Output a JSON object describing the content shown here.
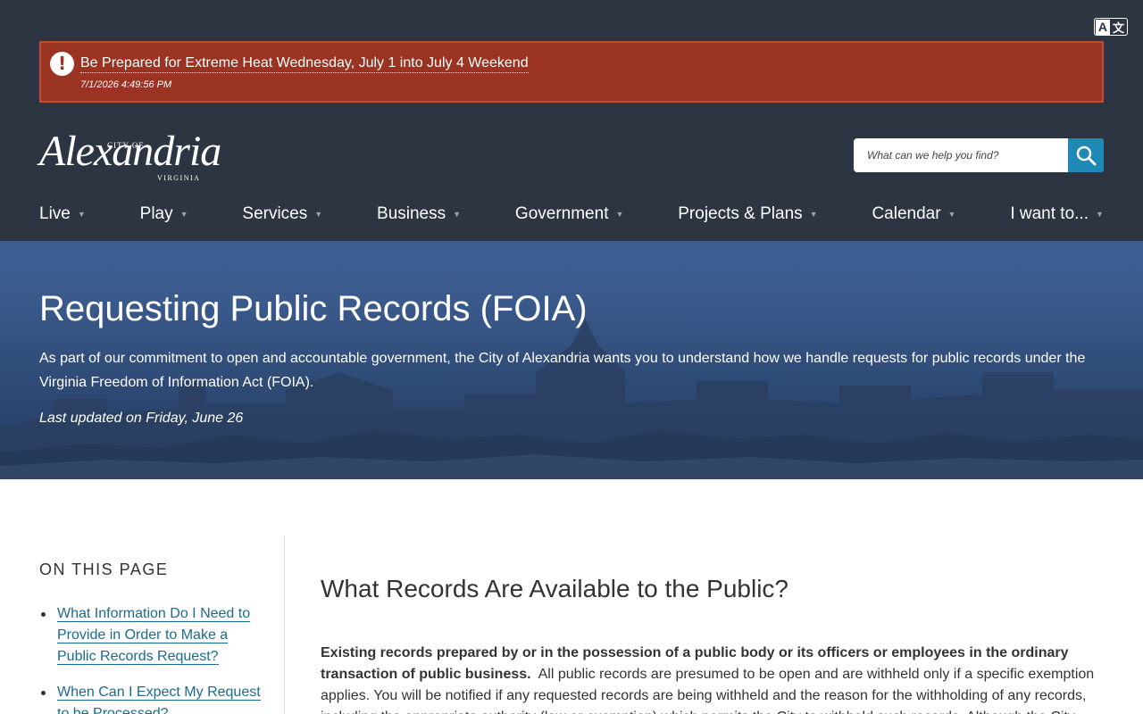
{
  "header": {
    "translate_label_a": "A",
    "translate_label_b": "文",
    "alert": {
      "title": "Be Prepared for Extreme Heat Wednesday, July 1 into July 4 Weekend",
      "timestamp": "7/1/2026 4:49:56 PM"
    },
    "logo": {
      "city_of": "CITY OF",
      "name": "Alexandria",
      "state": "VIRGINIA"
    },
    "search": {
      "placeholder": "What can we help you find?"
    },
    "nav": [
      {
        "label": "Live"
      },
      {
        "label": "Play"
      },
      {
        "label": "Services"
      },
      {
        "label": "Business"
      },
      {
        "label": "Government"
      },
      {
        "label": "Projects & Plans"
      },
      {
        "label": "Calendar"
      },
      {
        "label": "I want to..."
      }
    ]
  },
  "hero": {
    "title": "Requesting Public Records (FOIA)",
    "description": "As part of our commitment to open and accountable government, the City of Alexandria wants you to understand how we handle requests for public records under the Virginia Freedom of Information Act (FOIA).",
    "updated": "Last updated on Friday, June 26"
  },
  "sidebar": {
    "heading": "ON THIS PAGE",
    "links": [
      {
        "label": "What Information Do I Need to Provide in Order to Make a Public Records Request?"
      },
      {
        "label": "When Can I Expect My Request to be Processed?"
      }
    ]
  },
  "main": {
    "heading": "What Records Are Available to the Public?",
    "paragraph_bold": "Existing records prepared by or in the possession of a public body or its officers or employees in the ordinary transaction of public business.",
    "paragraph_rest": "All public records are presumed to be open and are withheld only if a specific exemption applies. You will be notified if any requested records are being withheld and the reason for the withholding of any records, including the appropriate authority (law or exemption) which permits the City to withhold such records. Although the City strives to"
  },
  "colors": {
    "header_bg": "#2c3541",
    "alert_bg": "#9a3322",
    "search_button": "#1e88b7",
    "link": "#1a6b8f"
  }
}
